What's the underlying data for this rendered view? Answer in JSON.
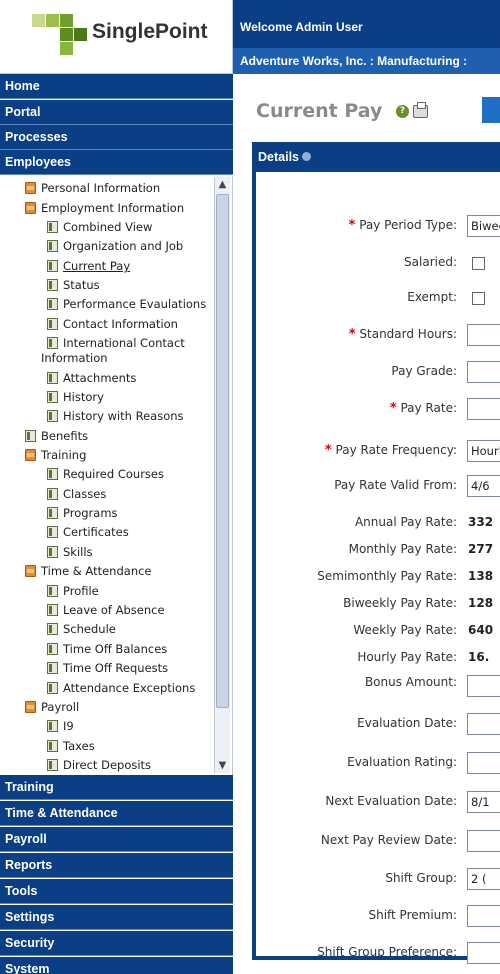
{
  "brand": {
    "name": "SinglePoint"
  },
  "header": {
    "welcome": "Welcome Admin User",
    "company": "Adventure Works, Inc. : Manufacturing :"
  },
  "nav": {
    "top": [
      "Home",
      "Portal",
      "Processes",
      "Employees"
    ],
    "bottom": [
      "Training",
      "Time & Attendance",
      "Payroll",
      "Reports",
      "Tools",
      "Settings",
      "Security",
      "System"
    ]
  },
  "tree": [
    {
      "label": "Personal Information",
      "icon": "folder-icon"
    },
    {
      "label": "Employment Information",
      "icon": "folder-icon"
    },
    {
      "label": "Combined View",
      "icon": "page-icon"
    },
    {
      "label": "Organization and Job",
      "icon": "page-icon"
    },
    {
      "label": "Current Pay",
      "icon": "page-icon"
    },
    {
      "label": "Status",
      "icon": "page-icon"
    },
    {
      "label": "Performance Evaulations",
      "icon": "page-icon"
    },
    {
      "label": "Contact Information",
      "icon": "page-icon"
    },
    {
      "label": "International Contact",
      "icon": "page-icon"
    },
    {
      "label": "Information",
      "icon": ""
    },
    {
      "label": "Attachments",
      "icon": "page-icon"
    },
    {
      "label": "History",
      "icon": "page-icon"
    },
    {
      "label": "History with Reasons",
      "icon": "page-icon"
    },
    {
      "label": "Benefits",
      "icon": "page-icon"
    },
    {
      "label": "Training",
      "icon": "folder-icon"
    },
    {
      "label": "Required Courses",
      "icon": "page-icon"
    },
    {
      "label": "Classes",
      "icon": "page-icon"
    },
    {
      "label": "Programs",
      "icon": "page-icon"
    },
    {
      "label": "Certificates",
      "icon": "page-icon"
    },
    {
      "label": "Skills",
      "icon": "page-icon"
    },
    {
      "label": "Time & Attendance",
      "icon": "folder-icon"
    },
    {
      "label": "Profile",
      "icon": "page-icon"
    },
    {
      "label": "Leave of Absence",
      "icon": "page-icon"
    },
    {
      "label": "Schedule",
      "icon": "page-icon"
    },
    {
      "label": "Time Off Balances",
      "icon": "page-icon"
    },
    {
      "label": "Time Off Requests",
      "icon": "page-icon"
    },
    {
      "label": "Attendance Exceptions",
      "icon": "page-icon"
    },
    {
      "label": "Payroll",
      "icon": "folder-icon"
    },
    {
      "label": "I9",
      "icon": "page-icon"
    },
    {
      "label": "Taxes",
      "icon": "page-icon"
    },
    {
      "label": "Direct Deposits",
      "icon": "page-icon"
    }
  ],
  "page": {
    "title": "Current Pay",
    "section": "Details"
  },
  "form": {
    "pay_period_type": {
      "label": "Pay Period Type:",
      "value": "Biweekly"
    },
    "salaried": {
      "label": "Salaried:"
    },
    "exempt": {
      "label": "Exempt:"
    },
    "standard_hours": {
      "label": "Standard Hours:",
      "value": ""
    },
    "pay_grade": {
      "label": "Pay Grade:",
      "value": ""
    },
    "pay_rate": {
      "label": "Pay Rate:",
      "value": ""
    },
    "pay_rate_frequency": {
      "label": "Pay Rate Frequency:",
      "value": "Hourly"
    },
    "pay_rate_valid_from": {
      "label": "Pay Rate Valid From:",
      "value": "4/6"
    },
    "annual_pay_rate": {
      "label": "Annual Pay Rate:",
      "value": "332"
    },
    "monthly_pay_rate": {
      "label": "Monthly Pay Rate:",
      "value": "277"
    },
    "semimonthly_pay_rate": {
      "label": "Semimonthly Pay Rate:",
      "value": "138"
    },
    "biweekly_pay_rate": {
      "label": "Biweekly Pay Rate:",
      "value": "128"
    },
    "weekly_pay_rate": {
      "label": "Weekly Pay Rate:",
      "value": "640"
    },
    "hourly_pay_rate": {
      "label": "Hourly Pay Rate:",
      "value": "16."
    },
    "bonus_amount": {
      "label": "Bonus Amount:",
      "value": ""
    },
    "evaluation_date": {
      "label": "Evaluation Date:",
      "value": ""
    },
    "evaluation_rating": {
      "label": "Evaluation Rating:",
      "value": ""
    },
    "next_evaluation_date": {
      "label": "Next Evaluation Date:",
      "value": "8/1"
    },
    "next_pay_review_date": {
      "label": "Next Pay Review Date:",
      "value": ""
    },
    "shift_group": {
      "label": "Shift Group:",
      "value": "2 ("
    },
    "shift_premium": {
      "label": "Shift Premium:",
      "value": ""
    },
    "shift_group_preference": {
      "label": "Shift Group Preference:",
      "value": ""
    }
  }
}
